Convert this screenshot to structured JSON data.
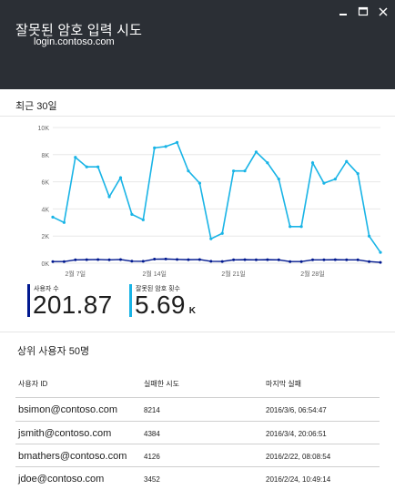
{
  "header": {
    "title": "잘못된 암호 입력 시도",
    "subtitle": "login.contoso.com",
    "controls": [
      "minimize-icon",
      "maximize-icon",
      "close-icon"
    ]
  },
  "section": {
    "label": "최근 30일"
  },
  "chart_data": {
    "type": "line",
    "title": "",
    "xlabel": "",
    "ylabel": "",
    "ylim": [
      0,
      10000
    ],
    "y_ticks": [
      "0K",
      "2K",
      "4K",
      "6K",
      "8K",
      "10K"
    ],
    "x_ticks": [
      {
        "label": "2월 7일",
        "index": 2
      },
      {
        "label": "2월 14일",
        "index": 9
      },
      {
        "label": "2월 21일",
        "index": 16
      },
      {
        "label": "2월 28일",
        "index": 23
      }
    ],
    "grid": true,
    "series": [
      {
        "name": "잘못된 암호 횟수",
        "color": "#19b4e6",
        "values": [
          3400,
          3000,
          7800,
          7100,
          7100,
          4900,
          6300,
          3600,
          3200,
          8500,
          8600,
          8900,
          6800,
          5900,
          1800,
          2200,
          6800,
          6800,
          8200,
          7400,
          6200,
          2700,
          2700,
          7400,
          5900,
          6200,
          7500,
          6600,
          2000,
          800
        ]
      },
      {
        "name": "사용자 수",
        "color": "#00188f",
        "values": [
          120,
          120,
          250,
          260,
          270,
          250,
          270,
          150,
          140,
          300,
          310,
          280,
          260,
          270,
          140,
          130,
          250,
          260,
          250,
          260,
          250,
          120,
          120,
          250,
          250,
          260,
          250,
          250,
          120,
          60
        ]
      }
    ]
  },
  "metrics": [
    {
      "label": "사용자 수",
      "value": "201.87",
      "unit": "",
      "color": "#00188f"
    },
    {
      "label": "잘못된 암호 횟수",
      "value": "5.69",
      "unit": "K",
      "color": "#19b4e6"
    }
  ],
  "users": {
    "title": "상위 사용자 50명",
    "columns": [
      "사용자 ID",
      "실패한 시도",
      "마지막 실패"
    ],
    "rows": [
      [
        "bsimon@contoso.com",
        "8214",
        "2016/3/6, 06:54:47"
      ],
      [
        "jsmith@contoso.com",
        "4384",
        "2016/3/4, 20:06:51"
      ],
      [
        "bmathers@contoso.com",
        "4126",
        "2016/2/22, 08:08:54"
      ],
      [
        "jdoe@contoso.com",
        "3452",
        "2016/2/24, 10:49:14"
      ]
    ]
  }
}
